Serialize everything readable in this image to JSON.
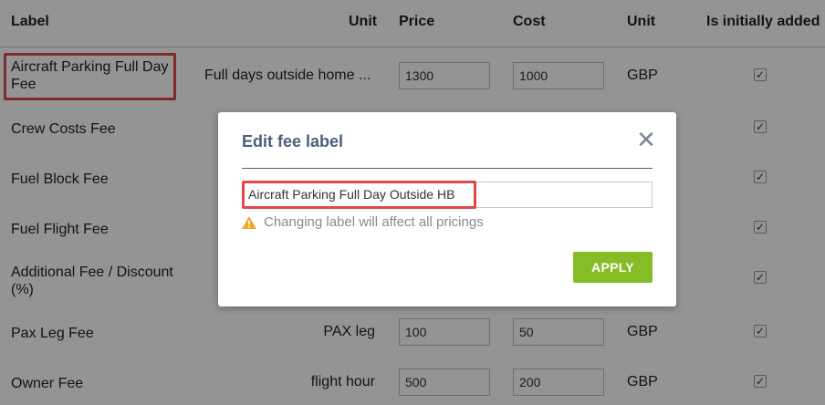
{
  "headers": {
    "label": "Label",
    "unit": "Unit",
    "price": "Price",
    "cost": "Cost",
    "currency_unit": "Unit",
    "initially_added": "Is initially added"
  },
  "rows": [
    {
      "label": "Aircraft Parking Full Day Fee",
      "unit": "Full days outside home ...",
      "price": "1300",
      "cost": "1000",
      "currency": "GBP",
      "added": true
    },
    {
      "label": "Crew Costs Fee",
      "added": true
    },
    {
      "label": "Fuel Block Fee",
      "added": true
    },
    {
      "label": "Fuel Flight Fee",
      "added": true
    },
    {
      "label": "Additional Fee / Discount (%)",
      "added": true
    },
    {
      "label": "Pax Leg Fee",
      "unit": "PAX leg",
      "price": "100",
      "cost": "50",
      "currency": "GBP",
      "added": true
    },
    {
      "label": "Owner Fee",
      "unit": "flight hour",
      "price": "500",
      "cost": "200",
      "currency": "GBP",
      "added": true
    }
  ],
  "modal": {
    "title": "Edit fee label",
    "input_value": "Aircraft Parking Full Day Outside HB",
    "warning": "Changing label will affect all pricings",
    "apply_label": "APPLY",
    "close_glyph": "✕"
  },
  "colors": {
    "apply_green": "#86bc25",
    "highlight_red": "#e0484a",
    "title_slate": "#4a5f7a"
  }
}
